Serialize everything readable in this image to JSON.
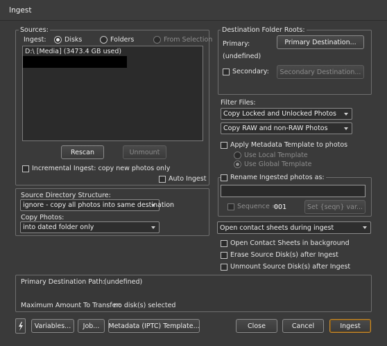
{
  "window": {
    "title": "Ingest"
  },
  "sources": {
    "legend": "Sources:",
    "ingest_label": "Ingest:",
    "radio_disks": "Disks",
    "radio_folders": "Folders",
    "radio_from_selection": "From Selection",
    "disk_item": "D:\\  [Media] (3473.4 GB used)",
    "rescan": "Rescan",
    "unmount": "Unmount",
    "incremental": "Incremental Ingest: copy new photos only",
    "auto_ingest": "Auto Ingest"
  },
  "source_structure": {
    "label": "Source Directory Structure:",
    "value": "ignore - copy all photos into same destination"
  },
  "copy_photos": {
    "label": "Copy Photos:",
    "value": "into dated folder only"
  },
  "destination": {
    "legend": "Destination Folder Roots:",
    "primary_label": "Primary:",
    "primary_button": "Primary Destination...",
    "primary_value": "(undefined)",
    "secondary_label": "Secondary:",
    "secondary_button": "Secondary Destination..."
  },
  "filter": {
    "label": "Filter Files:",
    "locked_select": "Copy Locked and Unlocked Photos",
    "raw_select": "Copy RAW and non-RAW Photos",
    "apply_metadata": "Apply Metadata Template to photos",
    "use_local": "Use Local Template",
    "use_global": "Use Global Template"
  },
  "rename": {
    "label": "Rename Ingested photos as:",
    "sequence_label": "Sequence =",
    "sequence_value": "001",
    "set_button": "Set {seqn} var..."
  },
  "contact": {
    "select": "Open contact sheets during ingest",
    "background": "Open Contact Sheets in background",
    "erase": "Erase Source Disk(s) after Ingest",
    "unmount": "Unmount Source Disk(s) after Ingest"
  },
  "summary": {
    "primary_path_label": "Primary Destination Path:",
    "primary_path_value": "(undefined)",
    "max_label": "Maximum Amount To Transfer:",
    "max_value": "no disk(s) selected"
  },
  "footer": {
    "variables": "Variables...",
    "job": "Job...",
    "metadata": "Metadata (IPTC) Template...",
    "close": "Close",
    "cancel": "Cancel",
    "ingest": "Ingest"
  }
}
